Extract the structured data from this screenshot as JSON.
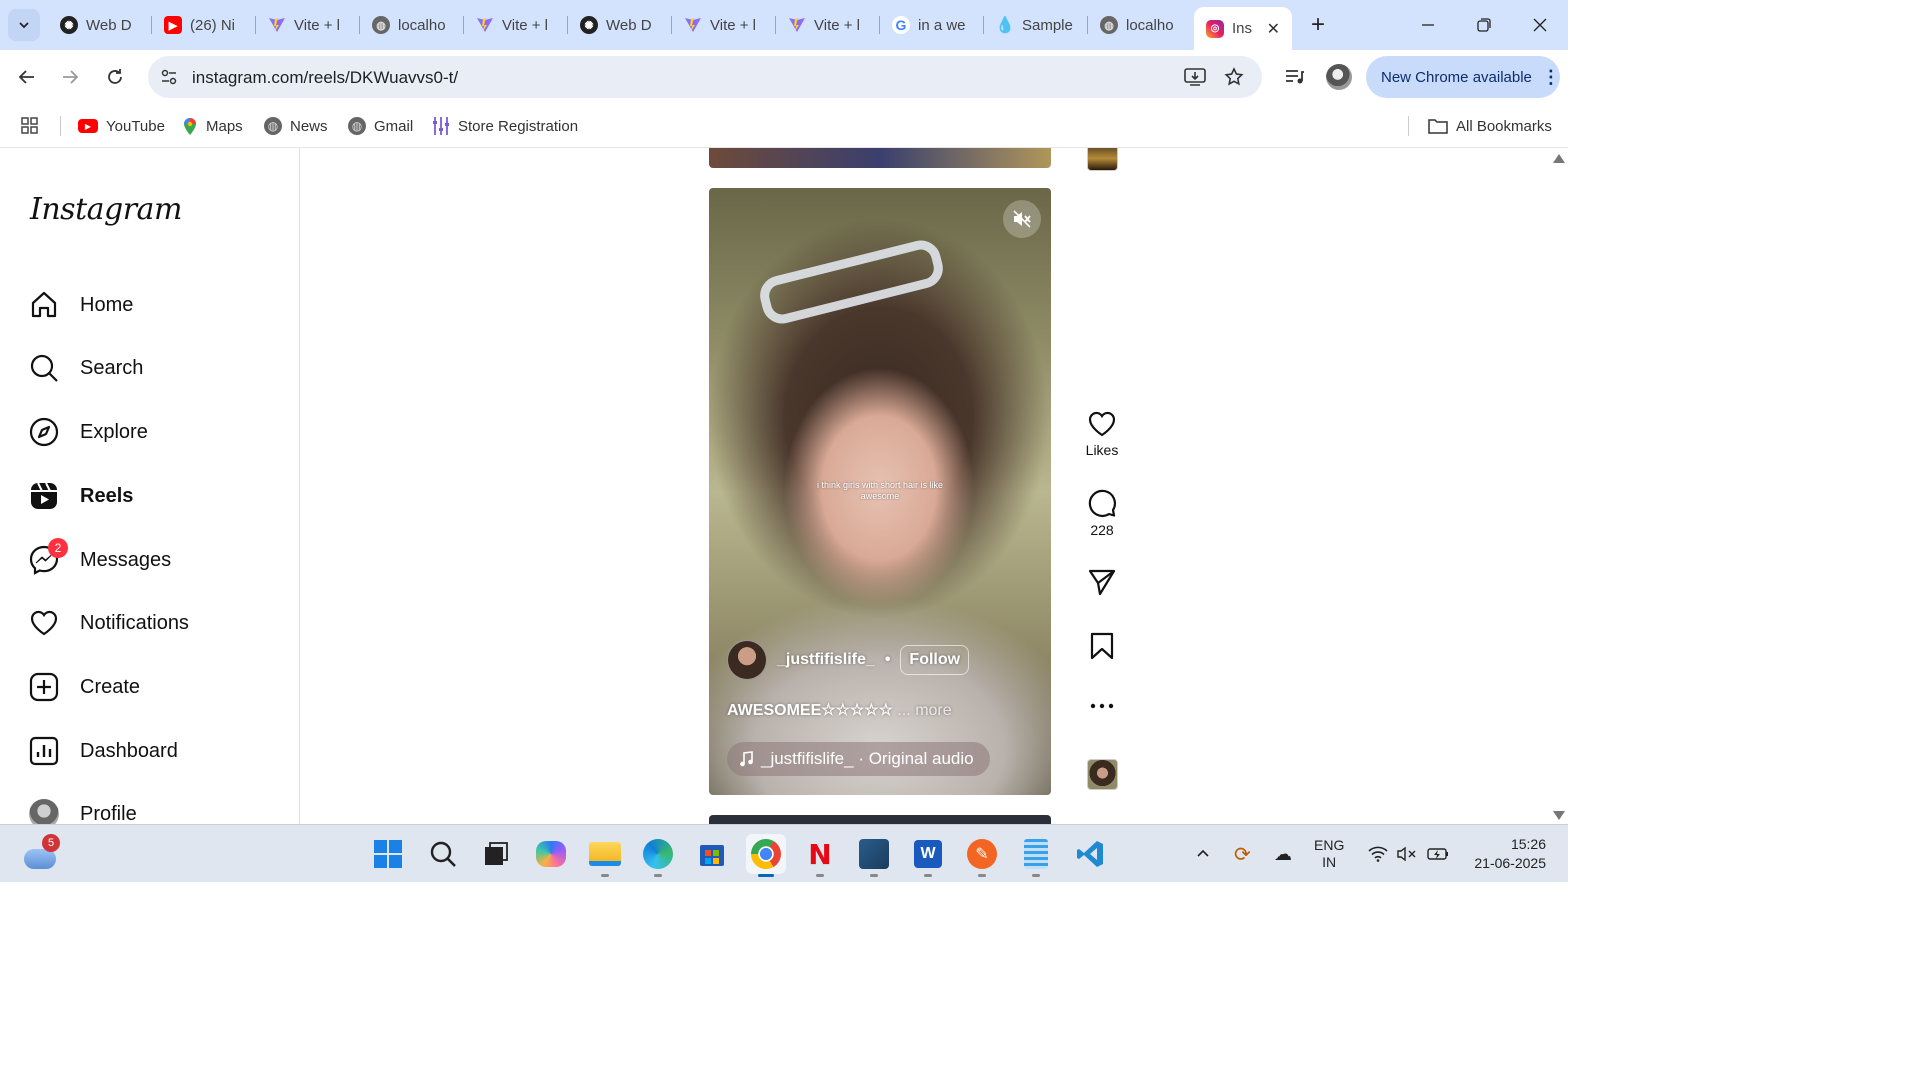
{
  "tabs": [
    {
      "label": "Web D",
      "icon": "openai-icon"
    },
    {
      "label": "(26) Ni",
      "icon": "youtube-icon"
    },
    {
      "label": "Vite + l",
      "icon": "vite-icon"
    },
    {
      "label": "localho",
      "icon": "globe-icon"
    },
    {
      "label": "Vite + l",
      "icon": "vite-icon"
    },
    {
      "label": "Web D",
      "icon": "openai-icon"
    },
    {
      "label": "Vite + l",
      "icon": "vite-icon"
    },
    {
      "label": "Vite + l",
      "icon": "vite-icon"
    },
    {
      "label": "in a we",
      "icon": "google-icon"
    },
    {
      "label": "Sample",
      "icon": "droplet-icon"
    },
    {
      "label": "localho",
      "icon": "globe-icon"
    },
    {
      "label": "Ins",
      "icon": "instagram-icon",
      "active": true
    }
  ],
  "address": {
    "url": "instagram.com/reels/DKWuavvs0-t/"
  },
  "chrome_update": {
    "label": "New Chrome available"
  },
  "bookmarks": {
    "items": [
      {
        "label": "YouTube"
      },
      {
        "label": "Maps"
      },
      {
        "label": "News"
      },
      {
        "label": "Gmail"
      },
      {
        "label": "Store Registration"
      }
    ],
    "all_label": "All Bookmarks"
  },
  "instagram": {
    "logo": "Instagram",
    "nav": [
      {
        "label": "Home"
      },
      {
        "label": "Search"
      },
      {
        "label": "Explore"
      },
      {
        "label": "Reels"
      },
      {
        "label": "Messages",
        "badge": "2"
      },
      {
        "label": "Notifications"
      },
      {
        "label": "Create"
      },
      {
        "label": "Dashboard"
      },
      {
        "label": "Profile"
      }
    ]
  },
  "reel": {
    "overlay_text": "i think girls with short hair is like awesome",
    "author": "_justfifislife_",
    "dot": "•",
    "follow": "Follow",
    "caption": "AWESOMEE☆☆☆☆☆",
    "more": "... more",
    "audio": "_justfifislife_ · Original audio"
  },
  "actions": {
    "likes_label": "Likes",
    "comments_count": "228"
  },
  "taskbar": {
    "weather_badge": "5",
    "lang_line1": "ENG",
    "lang_line2": "IN",
    "time": "15:26",
    "date": "21-06-2025"
  },
  "colors": {
    "tabstrip": "#d3e3fd",
    "chrome_update_bg": "#c9dbfa",
    "instagram_badge": "#ff3040",
    "taskbar": "#dfe6ef"
  }
}
